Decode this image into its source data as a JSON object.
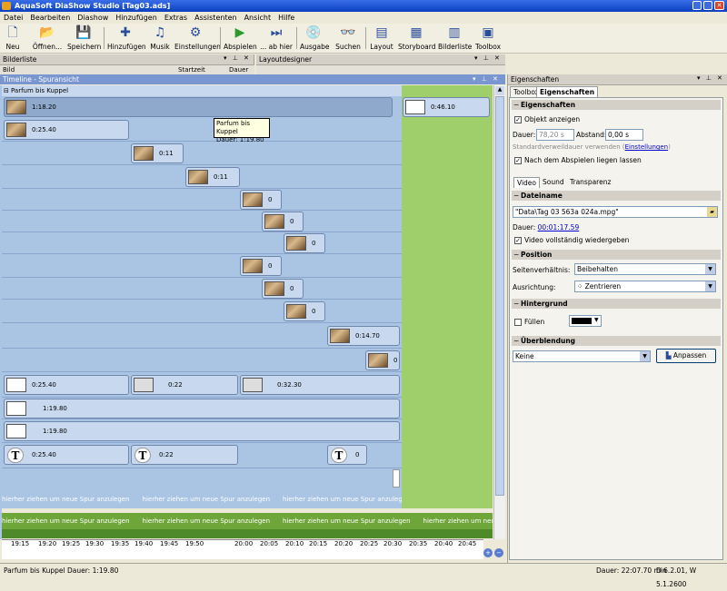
{
  "title": "AquaSoft DiaShow Studio [Tag03.ads]",
  "menu": [
    "Datei",
    "Bearbeiten",
    "Diashow",
    "Hinzufügen",
    "Extras",
    "Assistenten",
    "Ansicht",
    "Hilfe"
  ],
  "toolbar": {
    "neu": "Neu",
    "oeffnen": "Öffnen...",
    "speichern": "Speichern",
    "hinzufuegen": "Hinzufügen",
    "musik": "Musik",
    "einstellungen": "Einstellungen",
    "abspielen": "Abspielen",
    "abhier": "... ab hier",
    "ausgabe": "Ausgabe",
    "suchen": "Suchen",
    "layout": "Layout",
    "storyboard": "Storyboard",
    "bilderliste": "Bilderliste",
    "toolbox": "Toolbox"
  },
  "panes": {
    "bilderliste": "Bilderliste",
    "layoutdesigner": "Layoutdesigner",
    "timeline": "Timeline - Spuransicht",
    "eigenschaften": "Eigenschaften",
    "col_bild": "Bild",
    "col_startzeit": "Startzeit",
    "col_dauer": "Dauer"
  },
  "timeline": {
    "group": "Parfum bis Kuppel",
    "tooltip_title": "Parfum bis Kuppel",
    "tooltip_dauer": "Dauer: 1:19.80",
    "clips": [
      "1:18.20",
      "0:46.10",
      "0:25.40",
      "0:11",
      "0:11",
      "0",
      "0",
      "0",
      "0",
      "0",
      "0",
      "0:14.70",
      "0",
      "0:25.40",
      "0:22",
      "0:32.30",
      "1:19.80",
      "1:19.80",
      "0:25.40",
      "0:22",
      "0"
    ],
    "drag_hint": "hierher ziehen um neue Spur anzulegen",
    "ruler": [
      "19:15",
      "19:20",
      "19:25",
      "19:30",
      "19:35",
      "19:40",
      "19:45",
      "19:50",
      "20:00",
      "20:05",
      "20:10",
      "20:15",
      "20:20",
      "20:25",
      "20:30",
      "20:35",
      "20:40",
      "20:45"
    ]
  },
  "props": {
    "tab_toolbox": "Toolbox",
    "tab_eigenschaften": "Eigenschaften",
    "sect_eigenschaften": "Eigenschaften",
    "objekt_anzeigen": "Objekt anzeigen",
    "dauer_label": "Dauer:",
    "dauer_value": "78,20 s",
    "abstand_label": "Abstand:",
    "abstand_value": "0,00 s",
    "standard_text": "Standardverweildauer verwenden (",
    "einstellungen_link": "Einstellungen",
    "standard_close": ")",
    "liegen_lassen": "Nach dem Abspielen liegen lassen",
    "tab_video": "Video",
    "tab_sound": "Sound",
    "tab_transparenz": "Transparenz",
    "sect_dateiname": "Dateiname",
    "dateiname_value": "\"Data\\Tag 03 563a 024a.mpg\"",
    "video_dauer_label": "Dauer:",
    "video_dauer_value": "00:01:17.59",
    "video_vollstaendig": "Video vollständig wiedergeben",
    "sect_position": "Position",
    "seitenverhaeltnis_label": "Seitenverhältnis:",
    "seitenverhaeltnis_value": "Beibehalten",
    "ausrichtung_label": "Ausrichtung:",
    "ausrichtung_value": "Zentrieren",
    "sect_hintergrund": "Hintergrund",
    "fuellen": "Füllen",
    "sect_ueberblendung": "Überblendung",
    "ueberblendung_value": "Keine",
    "anpassen": "Anpassen"
  },
  "status": {
    "left": "Parfum bis Kuppel  Dauer: 1:19.80",
    "dauer": "Dauer: 22:07.70 min",
    "version": "D 6.2.01, W 5.1.2600"
  },
  "colors": {
    "title_bar": "#0a3fbf",
    "timeline_lane": "#aac4e4",
    "green_strip": "#9ecf6a"
  }
}
